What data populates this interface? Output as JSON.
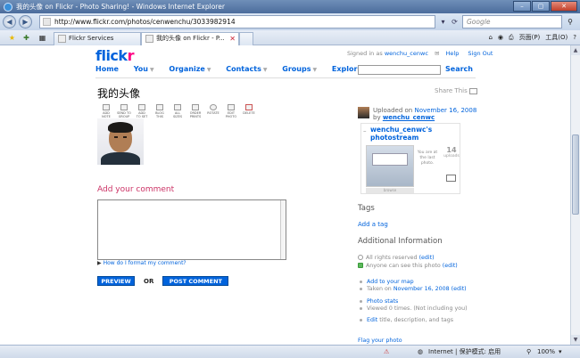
{
  "window": {
    "title": "我的头像 on Flickr - Photo Sharing! - Windows Internet Explorer",
    "url": "http://www.flickr.com/photos/cenwenchu/3033982914",
    "search_placeholder": "Google",
    "tabs": [
      {
        "label": "Flickr Services"
      },
      {
        "label": "我的头像 on Flickr - P..."
      }
    ],
    "cmd": {
      "page": "页面(P)",
      "tools": "工具(O)"
    }
  },
  "header": {
    "logo_main": "flick",
    "logo_r": "r",
    "signed_in_as": "Signed in as",
    "username": "wenchu_cenwc",
    "help": "Help",
    "sign_out": "Sign Out",
    "nav": [
      "Home",
      "You",
      "Organize",
      "Contacts",
      "Groups",
      "Explore"
    ],
    "search_label": "Search"
  },
  "photo": {
    "title": "我的头像",
    "share_this": "Share This",
    "actions": [
      [
        "ADD",
        "NOTE"
      ],
      [
        "SEND TO",
        "GROUP"
      ],
      [
        "ADD",
        "TO SET"
      ],
      [
        "BLOG",
        "THIS"
      ],
      [
        "ALL",
        "SIZES"
      ],
      [
        "ORDER",
        "PRINTS"
      ],
      [
        "ROTATE",
        ""
      ],
      [
        "EDIT",
        "PHOTO"
      ],
      [
        "DELETE",
        ""
      ]
    ]
  },
  "comment": {
    "heading": "Add your comment",
    "format_help": "How do I format my comment?",
    "preview": "PREVIEW",
    "or": "OR",
    "post": "POST COMMENT"
  },
  "sidebar": {
    "uploaded_on": "Uploaded on",
    "date": "November 16, 2008",
    "by": "by",
    "owner": "wenchu_cenwc",
    "stream_title": "wenchu_cenwc's photostream",
    "last_photo": "You are at the last photo.",
    "uploads_count": "14",
    "uploads_label": "uploads",
    "browse": "browse",
    "tags_heading": "Tags",
    "add_tag": "Add a tag",
    "info_heading": "Additional Information",
    "info": {
      "rights": "All rights reserved",
      "edit": "(edit)",
      "visibility": "Anyone can see this photo",
      "add_map": "Add to your map",
      "taken_on": "Taken on",
      "taken_date": "November 16, 2008",
      "stats": "Photo stats",
      "viewed": "Viewed 0 times. (Not including you)",
      "edit_title": "Edit",
      "edit_rest": "title, description, and tags",
      "flag": "Flag your photo"
    }
  },
  "status": {
    "internet": "Internet | 保护模式: 启用",
    "zoom": "100%"
  }
}
